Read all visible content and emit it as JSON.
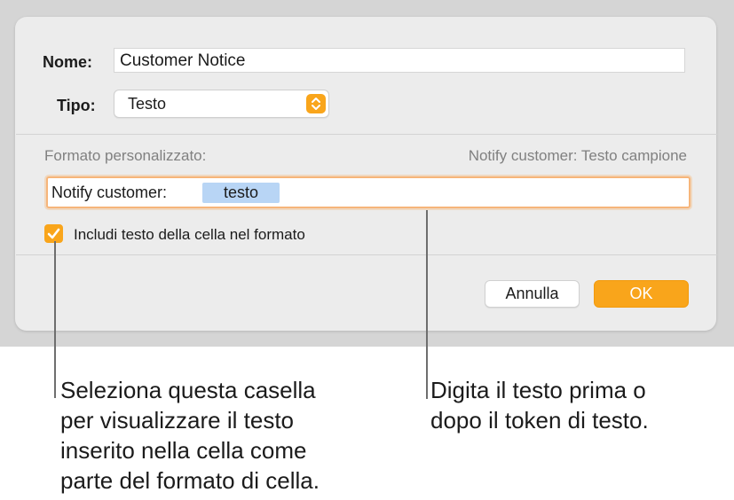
{
  "dialog": {
    "name": {
      "label": "Nome:",
      "value": "Customer Notice"
    },
    "type": {
      "label": "Tipo:",
      "selected": "Testo"
    },
    "custom_format": {
      "label": "Formato personalizzato:",
      "sample": "Notify customer: Testo campione",
      "prefix_text": "Notify customer:",
      "token": "testo"
    },
    "include_checkbox": {
      "label": "Includi testo della cella nel formato",
      "checked": true
    },
    "buttons": {
      "cancel": "Annulla",
      "ok": "OK"
    }
  },
  "callouts": {
    "left": [
      "Seleziona questa casella",
      "per visualizzare il testo",
      "inserito nella cella come",
      "parte del formato di cella."
    ],
    "right": [
      "Digita il testo prima o",
      "dopo il token di testo."
    ]
  },
  "colors": {
    "accent": "#f9a51b",
    "token_background": "#b8d5f5",
    "dialog_background": "#ececec"
  }
}
